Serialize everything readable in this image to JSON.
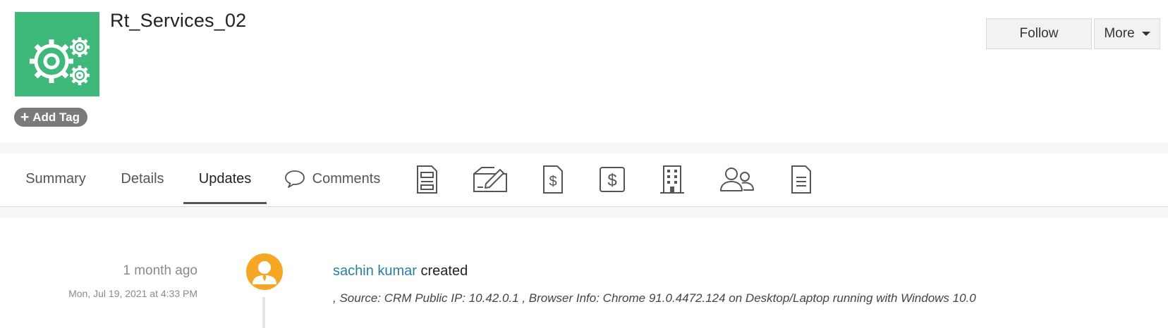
{
  "record": {
    "title": "Rt_Services_02",
    "icon": "gears-icon",
    "icon_bg": "#3fb97a",
    "add_tag_label": "Add Tag"
  },
  "actions": {
    "follow_label": "Follow",
    "more_label": "More"
  },
  "tabs": [
    {
      "label": "Summary"
    },
    {
      "label": "Details"
    },
    {
      "label": "Updates",
      "active": true
    },
    {
      "label": "Comments",
      "icon": "speech-bubble-icon"
    }
  ],
  "tab_icons": [
    "document-icon",
    "sign-document-icon",
    "invoice-icon",
    "dollar-icon",
    "building-icon",
    "contacts-icon",
    "note-icon"
  ],
  "timeline": [
    {
      "relative_time": "1 month ago",
      "timestamp": "Mon, Jul 19, 2021 at 4:33 PM",
      "user": "sachin kumar",
      "action": "created",
      "details": ", Source: CRM Public IP: 10.42.0.1 , Browser Info: Chrome 91.0.4472.124 on Desktop/Laptop running with Windows 10.0",
      "avatar_color": "#f5a623"
    }
  ],
  "colors": {
    "accent_link": "#2a7ea6",
    "tag_bg": "#7a7a7a"
  }
}
